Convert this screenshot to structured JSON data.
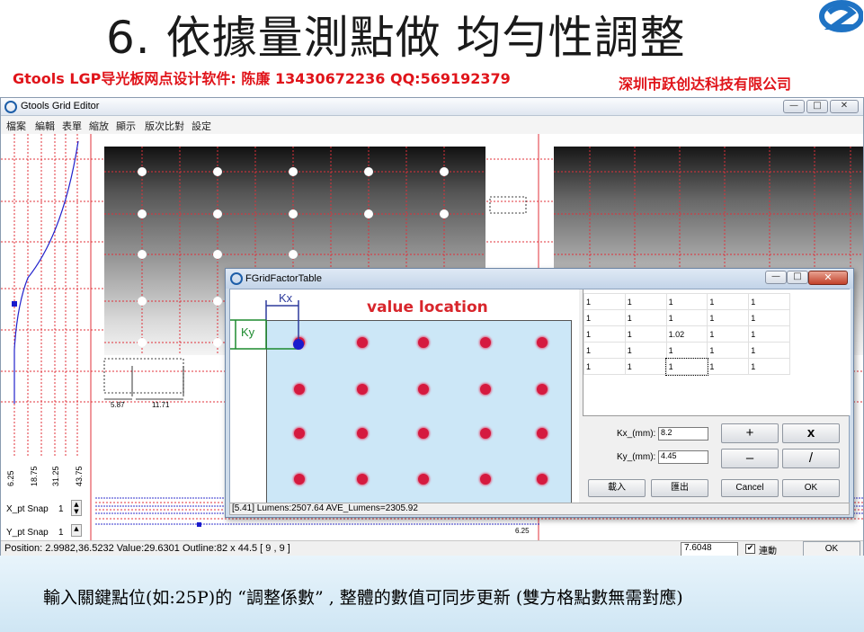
{
  "slide": {
    "title": "6. 依據量測點做 均勻性調整",
    "subtitle_left": "Gtools LGP导光板网点设计软件:   陈廉     13430672236     QQ:569192379",
    "subtitle_right": "深圳市跃创达科技有限公司",
    "caption": "輸入關鍵點位(如:25P)的 “調整係數” , 整體的數值可同步更新 (雙方格點數無需對應)"
  },
  "main_window": {
    "title": "Gtools Grid Editor",
    "menu": [
      "檔案",
      "編輯",
      "表單",
      "縮放",
      "顯示",
      "版次比對",
      "設定"
    ],
    "controls": {
      "minimize": "—",
      "maximize": "□",
      "close": "✕"
    },
    "snap": {
      "x_label": "X_pt Snap",
      "x_value": "1",
      "y_label": "Y_pt Snap",
      "y_value": "1"
    },
    "axis_labels": [
      "6.25",
      "18.75",
      "31.25",
      "43.75"
    ],
    "dims": {
      "a": "5.87",
      "b": "11.71",
      "right": "6.25"
    },
    "status": {
      "text": "Position: 2.9982,36.5232 Value:29.6301 Outline:82 x 44.5 [ 9 , 9 ]",
      "value_input": "7.6048",
      "link_label": "連動",
      "link_checked": "✔",
      "ok_label": "OK"
    }
  },
  "dialog": {
    "title": "FGridFactorTable",
    "controls": {
      "minimize": "—",
      "maximize": "□",
      "close": "✕"
    },
    "annotation": "value location",
    "kx_label": "Kx",
    "ky_label": "Ky",
    "table": [
      [
        "1",
        "1",
        "1",
        "1",
        "1"
      ],
      [
        "1",
        "1",
        "1",
        "1",
        "1"
      ],
      [
        "1",
        "1",
        "1.02",
        "1",
        "1"
      ],
      [
        "1",
        "1",
        "1",
        "1",
        "1"
      ],
      [
        "1",
        "1",
        "1",
        "1",
        "1"
      ]
    ],
    "kx_field_label": "Kx_(mm):",
    "kx_value": "8.2",
    "ky_field_label": "Ky_(mm):",
    "ky_value": "4.45",
    "ops": {
      "plus": "+",
      "times": "x",
      "minus": "–",
      "divide": "/"
    },
    "buttons": {
      "import": "載入",
      "export": "匯出",
      "cancel": "Cancel",
      "ok": "OK"
    },
    "status": "[5.41] Lumens:2507.64 AVE_Lumens=2305.92"
  },
  "colors": {
    "title_red": "#e0141a",
    "grid_red": "#e0303a",
    "dot_red": "#d51a3f",
    "sketch_bg": "#cce7f7"
  }
}
